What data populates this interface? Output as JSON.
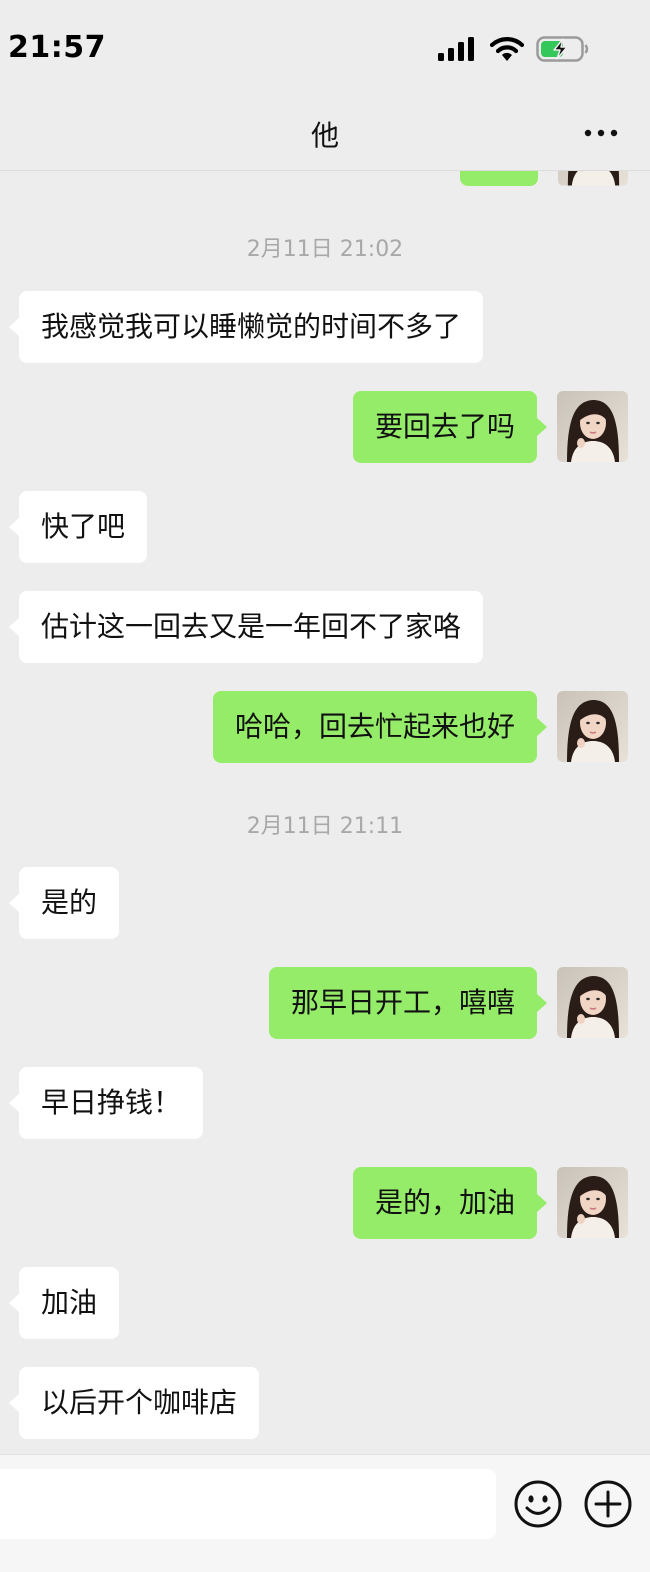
{
  "status_bar": {
    "time": "21:57"
  },
  "nav": {
    "title": "他",
    "more_icon": "more-icon"
  },
  "messages": [
    {
      "kind": "timestamp",
      "text": "2月11日 21:02"
    },
    {
      "kind": "in",
      "text": "我感觉我可以睡懒觉的时间不多了"
    },
    {
      "kind": "out",
      "text": "要回去了吗"
    },
    {
      "kind": "in",
      "text": "快了吧"
    },
    {
      "kind": "in",
      "text": "估计这一回去又是一年回不了家咯"
    },
    {
      "kind": "out",
      "text": "哈哈，回去忙起来也好"
    },
    {
      "kind": "timestamp",
      "text": "2月11日 21:11"
    },
    {
      "kind": "in",
      "text": "是的"
    },
    {
      "kind": "out",
      "text": "那早日开工，嘻嘻"
    },
    {
      "kind": "in",
      "text": "早日挣钱！"
    },
    {
      "kind": "out",
      "text": "是的，加油"
    },
    {
      "kind": "in",
      "text": "加油"
    },
    {
      "kind": "in",
      "text": "以后开个咖啡店"
    }
  ],
  "input_bar": {
    "value": "",
    "emoji_icon": "smiley-icon",
    "plus_icon": "plus-circle-icon"
  },
  "colors": {
    "background": "#ededed",
    "sent_bubble": "#95ec69",
    "received_bubble": "#ffffff",
    "timestamp_text": "#a8a8a8"
  }
}
